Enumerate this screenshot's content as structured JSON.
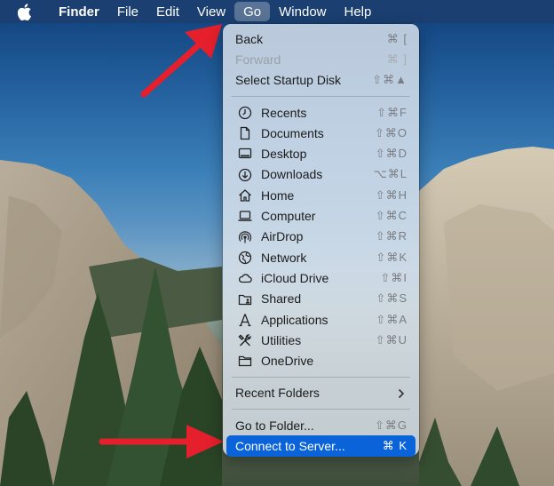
{
  "menubar": {
    "items": [
      {
        "label": "Finder"
      },
      {
        "label": "File"
      },
      {
        "label": "Edit"
      },
      {
        "label": "View"
      },
      {
        "label": "Go"
      },
      {
        "label": "Window"
      },
      {
        "label": "Help"
      }
    ]
  },
  "go_menu": {
    "section1": [
      {
        "label": "Back",
        "shortcut": "⌘ ["
      },
      {
        "label": "Forward",
        "shortcut": "⌘ ]"
      },
      {
        "label": "Select Startup Disk",
        "shortcut": "⇧⌘▲"
      }
    ],
    "places": [
      {
        "label": "Recents",
        "shortcut": "⇧⌘F",
        "icon": "clock-icon"
      },
      {
        "label": "Documents",
        "shortcut": "⇧⌘O",
        "icon": "document-icon"
      },
      {
        "label": "Desktop",
        "shortcut": "⇧⌘D",
        "icon": "desktop-icon"
      },
      {
        "label": "Downloads",
        "shortcut": "⌥⌘L",
        "icon": "download-icon"
      },
      {
        "label": "Home",
        "shortcut": "⇧⌘H",
        "icon": "home-icon"
      },
      {
        "label": "Computer",
        "shortcut": "⇧⌘C",
        "icon": "laptop-icon"
      },
      {
        "label": "AirDrop",
        "shortcut": "⇧⌘R",
        "icon": "airdrop-icon"
      },
      {
        "label": "Network",
        "shortcut": "⇧⌘K",
        "icon": "network-globe-icon"
      },
      {
        "label": "iCloud Drive",
        "shortcut": "⇧⌘I",
        "icon": "cloud-icon"
      },
      {
        "label": "Shared",
        "shortcut": "⇧⌘S",
        "icon": "shared-folder-icon"
      },
      {
        "label": "Applications",
        "shortcut": "⇧⌘A",
        "icon": "applications-icon"
      },
      {
        "label": "Utilities",
        "shortcut": "⇧⌘U",
        "icon": "utilities-icon"
      },
      {
        "label": "OneDrive",
        "shortcut": "",
        "icon": "folder-icon"
      }
    ],
    "recent_folders": {
      "label": "Recent Folders"
    },
    "go_to_folder": {
      "label": "Go to Folder...",
      "shortcut": "⇧⌘G"
    },
    "connect_to_server": {
      "label": "Connect to Server...",
      "shortcut": "⌘ K"
    }
  },
  "colors": {
    "menubar_bg": "#1a3f70",
    "highlight": "#0a63d9",
    "annotation_arrow": "#e5202c"
  }
}
